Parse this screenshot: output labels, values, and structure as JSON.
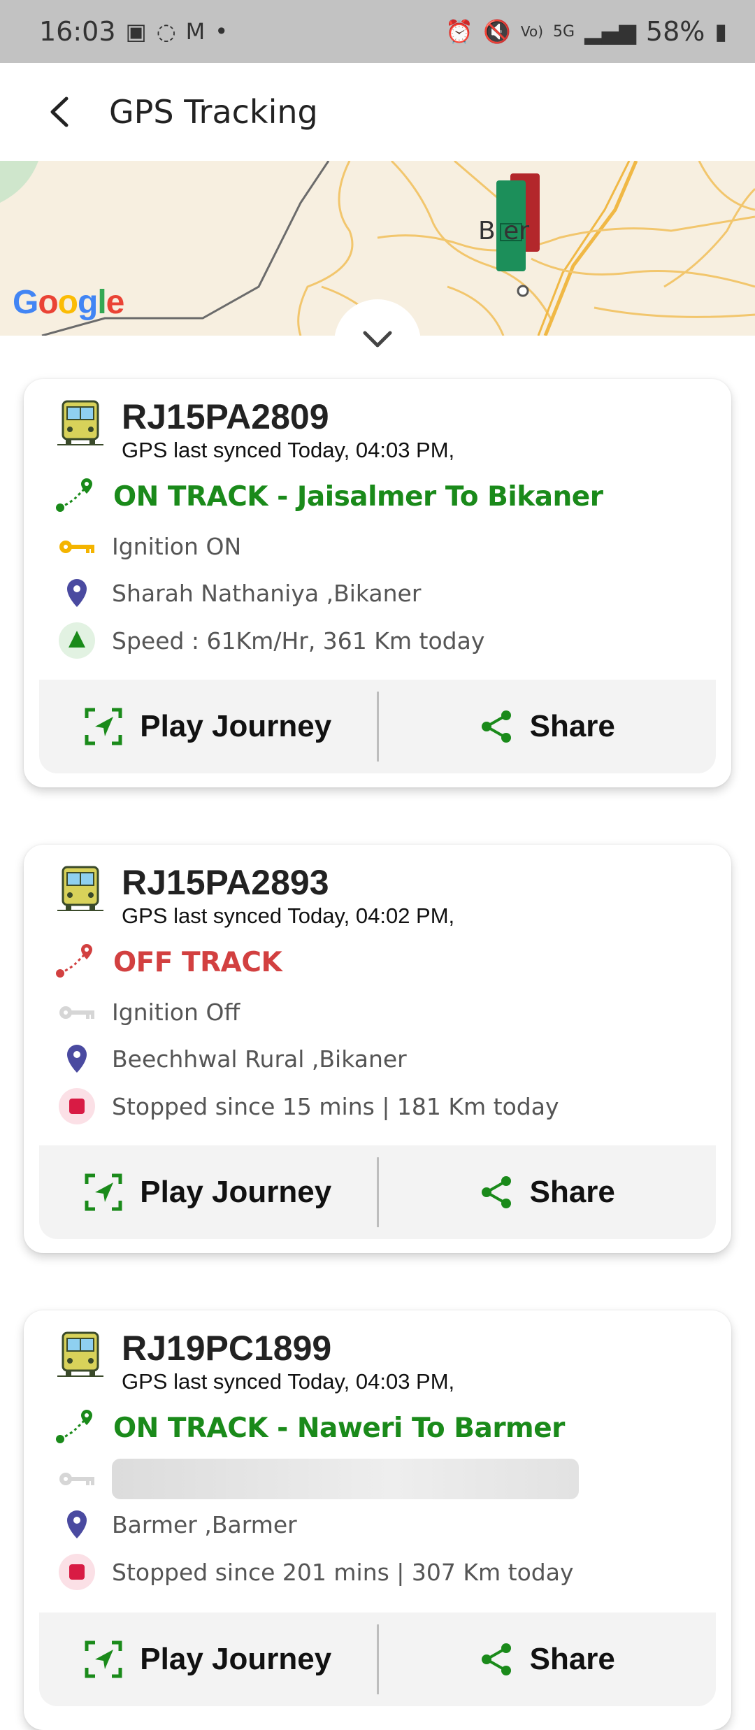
{
  "status_bar": {
    "time": "16:03",
    "battery": "58%"
  },
  "header": {
    "title": "GPS Tracking"
  },
  "map": {
    "provider_logo": "Google",
    "city_label": "B    er"
  },
  "actions": {
    "play_label": "Play Journey",
    "share_label": "Share"
  },
  "colors": {
    "on_track": "#1a8a1a",
    "off_track": "#d24040",
    "ignition_on": "#f4b400",
    "pin": "#4a4aa0"
  },
  "vehicles": [
    {
      "number": "RJ15PA2809",
      "synced": "GPS last synced Today, 04:03 PM,",
      "status": "ON TRACK  -  Jaisalmer To Bikaner",
      "ignition": "Ignition ON",
      "location": "Sharah Nathaniya ,Bikaner",
      "speed": "Speed : 61Km/Hr, 361 Km today"
    },
    {
      "number": "RJ15PA2893",
      "synced": "GPS last synced Today, 04:02 PM,",
      "status": "OFF TRACK",
      "ignition": "Ignition Off",
      "location": "Beechhwal Rural ,Bikaner",
      "speed": "Stopped since 15 mins |  181 Km today"
    },
    {
      "number": "RJ19PC1899",
      "synced": "GPS last synced Today, 04:03 PM,",
      "status": "ON TRACK  -  Naweri To Barmer",
      "ignition": "",
      "location": "Barmer ,Barmer",
      "speed": "Stopped since 201 mins |  307 Km today"
    }
  ]
}
